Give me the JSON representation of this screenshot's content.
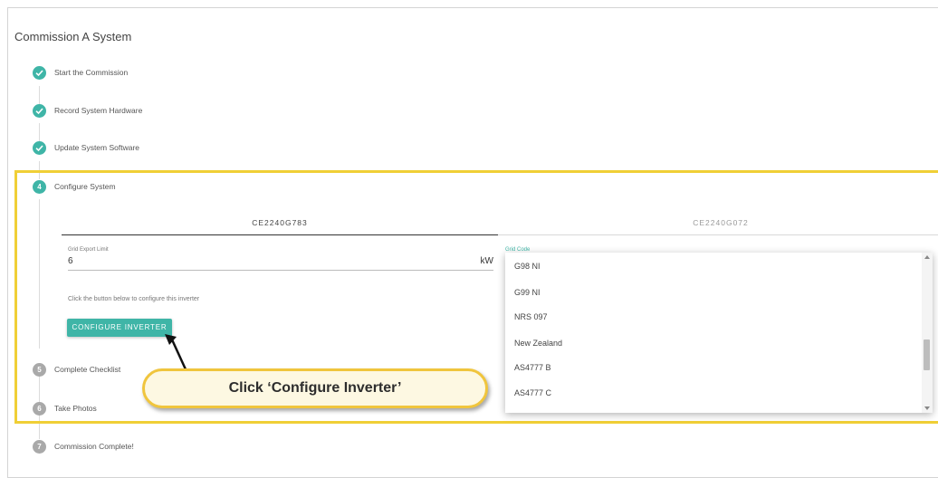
{
  "page": {
    "title": "Commission A System"
  },
  "steps": [
    {
      "number": "1",
      "label": "Start the Commission",
      "state": "done"
    },
    {
      "number": "2",
      "label": "Record System Hardware",
      "state": "done"
    },
    {
      "number": "3",
      "label": "Update System Software",
      "state": "done"
    },
    {
      "number": "4",
      "label": "Configure System",
      "state": "active"
    },
    {
      "number": "5",
      "label": "Complete Checklist",
      "state": "pending"
    },
    {
      "number": "6",
      "label": "Take Photos",
      "state": "pending"
    },
    {
      "number": "7",
      "label": "Commission Complete!",
      "state": "pending"
    }
  ],
  "configure": {
    "tabs": [
      {
        "label": "CE2240G783",
        "active": true
      },
      {
        "label": "CE2240G072",
        "active": false
      }
    ],
    "grid_export": {
      "label": "Grid Export Limit",
      "value": "6",
      "unit": "kW"
    },
    "grid_code": {
      "label": "Grid Code",
      "options": [
        "G98 NI",
        "G99 NI",
        "NRS 097",
        "New Zealand",
        "AS4777 B",
        "AS4777 C"
      ]
    },
    "hint": "Click the button below to configure this inverter",
    "button_label": "CONFIGURE INVERTER"
  },
  "callout": {
    "text": "Click ‘Configure Inverter’"
  },
  "colors": {
    "accent": "#3fb5a7",
    "highlight": "#f0cf36",
    "pending": "#a9a9a9"
  },
  "icons": {
    "done": "check-circle-icon"
  }
}
